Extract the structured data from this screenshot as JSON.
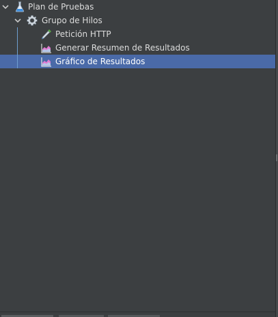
{
  "tree": {
    "nodes": [
      {
        "label": "Plan de Pruebas",
        "icon": "flask-icon",
        "expanded": true
      },
      {
        "label": "Grupo de Hilos",
        "icon": "gear-icon",
        "expanded": true
      },
      {
        "label": "Petición HTTP",
        "icon": "pipette-icon"
      },
      {
        "label": "Generar Resumen de Resultados",
        "icon": "chart-icon"
      },
      {
        "label": "Gráfico de Resultados",
        "icon": "chart-icon",
        "selected": true
      }
    ]
  },
  "colors": {
    "background": "#3c3f41",
    "selection": "#4a6aa8",
    "guide_line": "#6f9fd0",
    "text": "#dcdcdc"
  }
}
